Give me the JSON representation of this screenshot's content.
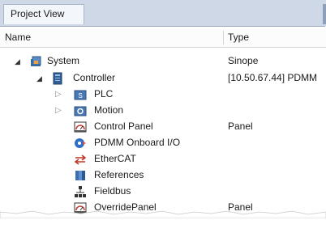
{
  "tabs": [
    {
      "label": "Project View"
    }
  ],
  "columns": {
    "name": "Name",
    "type": "Type"
  },
  "tree": [
    {
      "name": "System",
      "type": "Sinope",
      "icon": "system-icon",
      "level": 0,
      "expander": "open"
    },
    {
      "name": "Controller",
      "type": "[10.50.67.44] PDMM",
      "icon": "controller-icon",
      "level": 1,
      "expander": "open"
    },
    {
      "name": "PLC",
      "type": "",
      "icon": "plc-icon",
      "level": 2,
      "expander": "closed"
    },
    {
      "name": "Motion",
      "type": "",
      "icon": "motion-icon",
      "level": 2,
      "expander": "closed"
    },
    {
      "name": "Control Panel",
      "type": "Panel",
      "icon": "control-panel-icon",
      "level": 2,
      "expander": "none"
    },
    {
      "name": "PDMM Onboard I/O",
      "type": "",
      "icon": "onboard-io-icon",
      "level": 2,
      "expander": "none"
    },
    {
      "name": "EtherCAT",
      "type": "",
      "icon": "ethercat-icon",
      "level": 2,
      "expander": "none"
    },
    {
      "name": "References",
      "type": "",
      "icon": "references-icon",
      "level": 2,
      "expander": "none"
    },
    {
      "name": "Fieldbus",
      "type": "",
      "icon": "fieldbus-icon",
      "level": 2,
      "expander": "none"
    },
    {
      "name": "OverridePanel",
      "type": "Panel",
      "icon": "override-panel-icon",
      "level": 2,
      "expander": "none"
    }
  ]
}
